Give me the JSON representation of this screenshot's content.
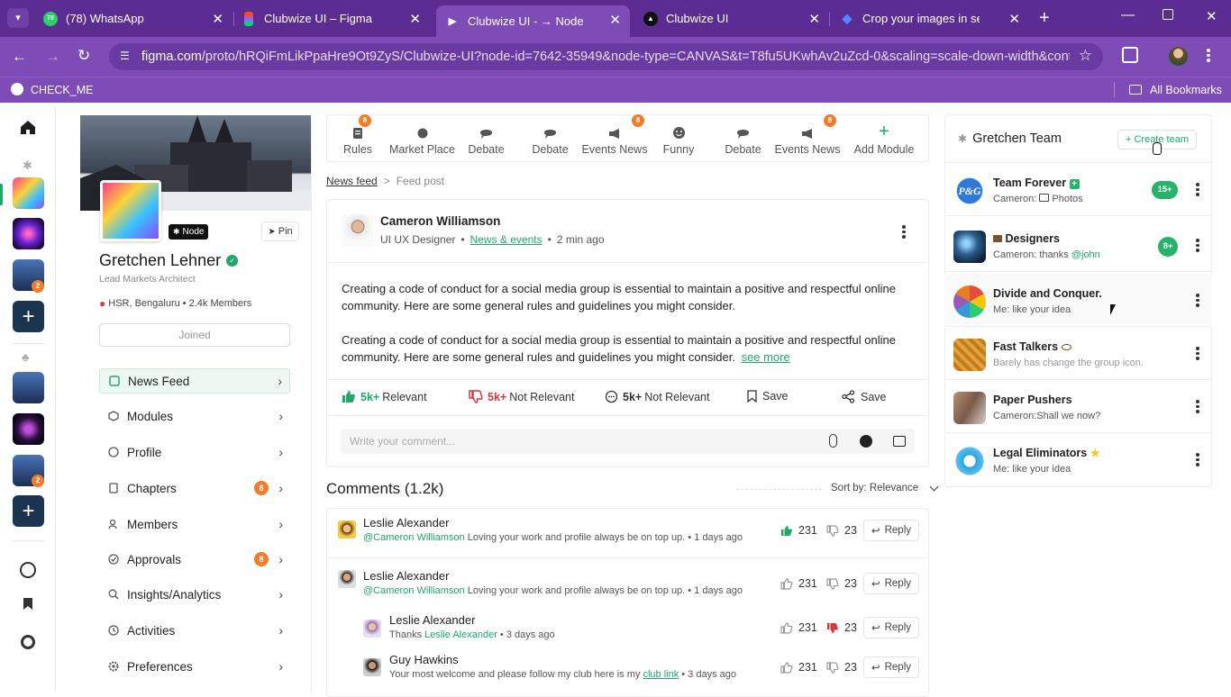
{
  "browser": {
    "tabs": [
      {
        "title": "(78) WhatsApp",
        "icon": "whatsapp-icon"
      },
      {
        "title": "Clubwize UI – Figma",
        "icon": "figma-icon"
      },
      {
        "title": "Clubwize UI - → Node",
        "icon": "play-icon"
      },
      {
        "title": "Clubwize UI",
        "icon": "notion-icon"
      },
      {
        "title": "Crop your images in seconds",
        "icon": "gem-icon"
      }
    ],
    "whatsapp_badge": "78",
    "url_host": "figma.com",
    "url_path": "/proto/hRQiFmLikPpaHre9Ot9ZyS/Clubwize-UI?node-id=7642-35949&node-type=CANVAS&t=T8fu5UKwhAv2uZcd-0&scaling=scale-down-width&conte...",
    "bookmark": "CHECK_ME",
    "all_bookmarks": "All Bookmarks"
  },
  "rail": {
    "badges": [
      "2",
      "2"
    ]
  },
  "profile": {
    "node_badge": "Node",
    "pin_label": "Pin",
    "name": "Gretchen Lehner",
    "role": "Lead Markets Architect",
    "location": "HSR, Bengaluru",
    "members": "2.4k Members",
    "joined_label": "Joined",
    "menu": [
      {
        "label": "News Feed",
        "icon": "news-feed-icon"
      },
      {
        "label": "Modules",
        "icon": "modules-icon"
      },
      {
        "label": "Profile",
        "icon": "info-icon"
      },
      {
        "label": "Chapters",
        "icon": "book-icon",
        "count": "8"
      },
      {
        "label": "Members",
        "icon": "members-icon"
      },
      {
        "label": "Approvals",
        "icon": "approval-icon",
        "count": "8"
      },
      {
        "label": "Insights/Analytics",
        "icon": "insights-icon"
      },
      {
        "label": "Activities",
        "icon": "history-icon"
      },
      {
        "label": "Preferences",
        "icon": "settings-icon"
      }
    ]
  },
  "modules": [
    {
      "label": "Rules",
      "badge": "8"
    },
    {
      "label": "Market Place"
    },
    {
      "label": "Debate"
    },
    {
      "label": "Debate"
    },
    {
      "label": "Events News",
      "badge": "8"
    },
    {
      "label": "Funny"
    },
    {
      "label": "Debate"
    },
    {
      "label": "Events News",
      "badge": "8"
    },
    {
      "label": "Add Module"
    }
  ],
  "breadcrumb": {
    "link": "News feed",
    "sep": ">",
    "current": "Feed post"
  },
  "post": {
    "author": "Cameron Williamson",
    "role": "UI UX Designer",
    "category": "News & events",
    "time": "2 min ago",
    "para1": "Creating a code of conduct for a social media group is essential to maintain a positive and respectful online community. Here are some general rules and guidelines you might consider.",
    "para2": "Creating a code of conduct for a social media group is essential to maintain a positive and respectful online community. Here are some general rules and guidelines you might consider.",
    "see_more": "see more",
    "reactions": [
      {
        "count": "5k+",
        "label": "Relevant"
      },
      {
        "count": "5k+",
        "label": "Not Relevant"
      },
      {
        "count": "5k+",
        "label": "Not Relevant"
      },
      {
        "label": "Save"
      },
      {
        "label": "Save"
      }
    ],
    "comment_placeholder": "Write your comment..."
  },
  "comments": {
    "title": "Comments (1.2k)",
    "sort": "Sort by: Relevance",
    "items": [
      {
        "name": "Leslie Alexander",
        "mention": "@Cameron Williamson",
        "text": "Loving your work and profile always be on top up.",
        "time": "1 days ago",
        "up": "231",
        "down": "23",
        "reply": "Reply"
      },
      {
        "name": "Leslie Alexander",
        "mention": "@Cameron Williamson",
        "text": "Loving your work and profile always be on top up.",
        "time": "1 days ago",
        "up": "231",
        "down": "23",
        "reply": "Reply"
      },
      {
        "name": "Leslie Alexander",
        "prefix": "Thanks",
        "mention": "Leslie Alexander",
        "time": "3 days ago",
        "up": "231",
        "down": "23",
        "reply": "Reply"
      },
      {
        "name": "Guy Hawkins",
        "text": "Your most welcome and please follow my club here is my",
        "link": "club link",
        "time": "3 days ago",
        "up": "231",
        "down": "23",
        "reply": "Reply"
      }
    ]
  },
  "teams": {
    "title": "Gretchen Team",
    "create": "+ Create team",
    "items": [
      {
        "name": "Team Forever",
        "sub": "Cameron:",
        "sub2": "Photos",
        "pill": "15+"
      },
      {
        "name": "Designers",
        "sub": "Cameron: thanks",
        "mention": "@john",
        "pill": "8+"
      },
      {
        "name": "Divide and Conquer.",
        "sub": "Me: like your idea"
      },
      {
        "name": "Fast Talkers",
        "sub": "Barely has change the group icon."
      },
      {
        "name": "Paper Pushers",
        "sub": "Cameron:Shall we now?"
      },
      {
        "name": "Legal Eliminators",
        "sub": "Me: like your idea"
      }
    ]
  },
  "colors": {
    "chrome": "#5b2c91",
    "chrome_light": "#7d4cb6",
    "accent": "#1fa86a",
    "badge": "#f07d2a",
    "dislike": "#d9363e"
  }
}
